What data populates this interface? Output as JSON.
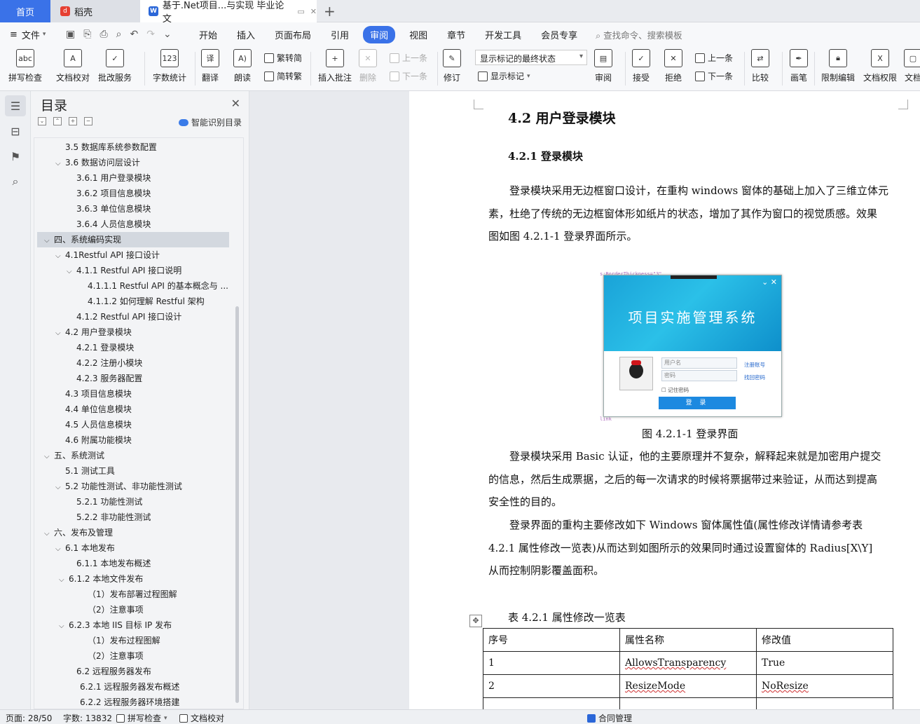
{
  "tabs": {
    "home": "首页",
    "wk": "稻壳",
    "doc": "基于.Net项目...与实现 毕业论文"
  },
  "menubar": {
    "file": "文件",
    "items": [
      "开始",
      "插入",
      "页面布局",
      "引用",
      "审阅",
      "视图",
      "章节",
      "开发工具",
      "会员专享"
    ],
    "active_index": 4,
    "search": "查找命令、搜索模板"
  },
  "ribbon": {
    "spell": "拼写检查",
    "proof": "文档校对",
    "batch": "批改服务",
    "wordcount": "字数统计",
    "translate": "翻译",
    "read": "朗读",
    "trad_to_simp": "繁转简",
    "simp_to_trad": "简转繁",
    "insert_comment": "插入批注",
    "delete": "删除",
    "prev_comment": "上一条",
    "next_comment": "下一条",
    "revise": "修订",
    "markup_state": "显示标记的最终状态",
    "show_markup": "显示标记",
    "review": "审阅",
    "accept": "接受",
    "reject": "拒绝",
    "prev": "上一条",
    "next": "下一条",
    "compare": "比较",
    "pen": "画笔",
    "restrict": "限制编辑",
    "rights": "文档权限",
    "more": "文档"
  },
  "toc": {
    "title": "目录",
    "smart": "智能识别目录",
    "items": [
      {
        "text": "3.5 数据库系统参数配置",
        "level": 2,
        "arrow": ""
      },
      {
        "text": "3.6 数据访问层设计",
        "level": 2,
        "arrow": "⌄"
      },
      {
        "text": "3.6.1  用户登录模块",
        "level": 3,
        "arrow": ""
      },
      {
        "text": "3.6.2  项目信息模块",
        "level": 3,
        "arrow": ""
      },
      {
        "text": "3.6.3  单位信息模块",
        "level": 3,
        "arrow": ""
      },
      {
        "text": "3.6.4  人员信息模块",
        "level": 3,
        "arrow": ""
      },
      {
        "text": "四、系统编码实现",
        "level": 1,
        "arrow": "⌄",
        "selected": true
      },
      {
        "text": "4.1Restful API 接口设计",
        "level": 2,
        "arrow": "⌄"
      },
      {
        "text": "4.1.1  Restful API 接口说明",
        "level": 3,
        "arrow": "⌄"
      },
      {
        "text": "4.1.1.1 Restful API 的基本概念与 ...",
        "level": 4,
        "arrow": ""
      },
      {
        "text": "4.1.1.2  如何理解 Restful 架构",
        "level": 4,
        "arrow": ""
      },
      {
        "text": "4.1.2 Restful API 接口设计",
        "level": 3,
        "arrow": ""
      },
      {
        "text": "4.2 用户登录模块",
        "level": 2,
        "arrow": "⌄"
      },
      {
        "text": "4.2.1 登录模块",
        "level": 3,
        "arrow": ""
      },
      {
        "text": "4.2.2 注册小模块",
        "level": 3,
        "arrow": ""
      },
      {
        "text": "4.2.3 服务器配置",
        "level": 3,
        "arrow": ""
      },
      {
        "text": "4.3 项目信息模块",
        "level": 2,
        "arrow": ""
      },
      {
        "text": "4.4 单位信息模块",
        "level": 2,
        "arrow": ""
      },
      {
        "text": "4.5 人员信息模块",
        "level": 2,
        "arrow": ""
      },
      {
        "text": "4.6 附属功能模块",
        "level": 2,
        "arrow": ""
      },
      {
        "text": "五、系统测试",
        "level": 1,
        "arrow": "⌄"
      },
      {
        "text": "5.1 测试工具",
        "level": 2,
        "arrow": ""
      },
      {
        "text": "5.2 功能性测试、非功能性测试",
        "level": 2,
        "arrow": "⌄"
      },
      {
        "text": "5.2.1  功能性测试",
        "level": 3,
        "arrow": ""
      },
      {
        "text": "5.2.2  非功能性测试",
        "level": 3,
        "arrow": ""
      },
      {
        "text": "六、发布及管理",
        "level": 1,
        "arrow": "⌄"
      },
      {
        "text": "6.1 本地发布",
        "level": 2,
        "arrow": "⌄"
      },
      {
        "text": "6.1.1  本地发布概述",
        "level": 3,
        "arrow": ""
      },
      {
        "text": "6.1.2  本地文件发布",
        "level": 2.5,
        "arrow": "⌄"
      },
      {
        "text": "（1）发布部署过程图解",
        "level": 4,
        "arrow": ""
      },
      {
        "text": "（2）注意事项",
        "level": 4,
        "arrow": ""
      },
      {
        "text": "6.2.3  本地 IIS 目标 IP 发布",
        "level": 2.5,
        "arrow": "⌄"
      },
      {
        "text": "（1）发布过程图解",
        "level": 4,
        "arrow": ""
      },
      {
        "text": "（2）注意事项",
        "level": 4,
        "arrow": ""
      },
      {
        "text": "6.2  远程服务器发布",
        "level": 3,
        "arrow": ""
      },
      {
        "text": "6.2.1 远程服务器发布概述",
        "level": 3.5,
        "arrow": ""
      },
      {
        "text": "6.2.2 远程服务器环境搭建",
        "level": 3.5,
        "arrow": ""
      }
    ]
  },
  "doc": {
    "h2": "4.2 用户登录模块",
    "h3": "4.2.1 登录模块",
    "p1": [
      "　　登录模块采用无边框窗口设计，在重构 windows 窗体的基础上加入了三维立体元",
      "素，杜绝了传统的无边框窗体形如纸片的状态，增加了其作为窗口的视觉质感。效果",
      "图如图 4.2.1-1 登录界面所示。"
    ],
    "figure": {
      "title": "项目实施管理系统",
      "username_placeholder": "用户名",
      "password_placeholder": "密码",
      "register": "注册账号",
      "recover": "找回密码",
      "remember": "记住密码",
      "login": "登 录"
    },
    "caption": "图 4.2.1-1 登录界面",
    "p2": [
      "　　登录模块采用 Basic 认证，他的主要原理并不复杂，解释起来就是加密用户提交",
      "的信息，然后生成票据，之后的每一次请求的时候将票据带过来验证，从而达到提高",
      "安全性的目的。"
    ],
    "p3": [
      "　　登录界面的重构主要修改如下 Windows 窗体属性值(属性修改详情请参考表",
      "4.2.1 属性修改一览表)从而达到如图所示的效果同时通过设置窗体的 Radius[X\\Y]",
      "从而控制阴影覆盖面积。"
    ],
    "table_caption": "表 4.2.1 属性修改一览表",
    "table": {
      "headers": [
        "序号",
        "属性名称",
        "修改值"
      ],
      "rows": [
        [
          "1",
          "AllowsTransparency",
          "True"
        ],
        [
          "2",
          "ResizeMode",
          "NoResize"
        ]
      ]
    }
  },
  "status": {
    "page": "页面: 28/50",
    "words": "字数: 13832",
    "spell": "拼写检查",
    "proof": "文档校对",
    "contract": "合同管理"
  }
}
